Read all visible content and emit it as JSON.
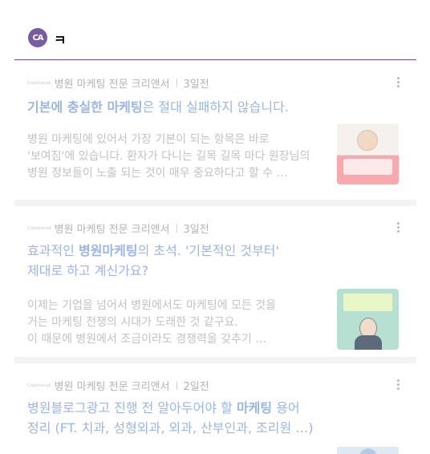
{
  "header": {
    "logo_text": "CA",
    "search_text": "ㅋ",
    "accent_color": "#6b4e96"
  },
  "posts": [
    {
      "brand": "Creativecall",
      "author": "병원 마케팅 전문 크리앤서",
      "time": "3일전",
      "title_parts": [
        {
          "text": "기본에 충실한 마케팅",
          "bold": true
        },
        {
          "text": "은 절대 실패하지 않습니다.",
          "bold": false
        }
      ],
      "excerpt": [
        "병원 마케팅에 있어서 가장 기본이 되는 항목은 바로",
        "'보여짐'에 있습니다. 환자가 다니는 길목 길목 마다 원장님의",
        "병원 정보들이 노출 되는 것이 매우 중요하다고 할 수 …"
      ],
      "thumbnail_icon": "doctor-portrait-thumbnail"
    },
    {
      "brand": "Creativecall",
      "author": "병원 마케팅 전문 크리앤서",
      "time": "3일전",
      "title_parts": [
        {
          "text": "효과적인 ",
          "bold": false
        },
        {
          "text": "병원마케팅",
          "bold": true
        },
        {
          "text": "의 초석. '기본적인 것부터'",
          "bold": false
        }
      ],
      "title_line2": "제대로 하고 계신가요?",
      "excerpt": [
        "이제는 기업을 넘어서 병원에서도 마케팅에 모든 것을",
        "거는 마케팅 전쟁의 시대가 도래한 것 같구요.",
        "이 때문에 병원에서 조금이라도 경쟁력을 갖추기 …"
      ],
      "thumbnail_icon": "businessman-illustration-thumbnail"
    },
    {
      "brand": "Creativecall",
      "author": "병원 마케팅 전문 크리앤서",
      "time": "2일전",
      "title_parts": [
        {
          "text": "병원블로그광고 진행 전 알아두어야 할 ",
          "bold": false
        },
        {
          "text": "마케팅",
          "bold": true
        },
        {
          "text": " 용어",
          "bold": false
        }
      ],
      "title_line2": "정리 (FT. 치과, 성형외과, 외과, 산부인과, 조리원 …)",
      "thumbnail_icon": "illustration-thumbnail"
    }
  ]
}
